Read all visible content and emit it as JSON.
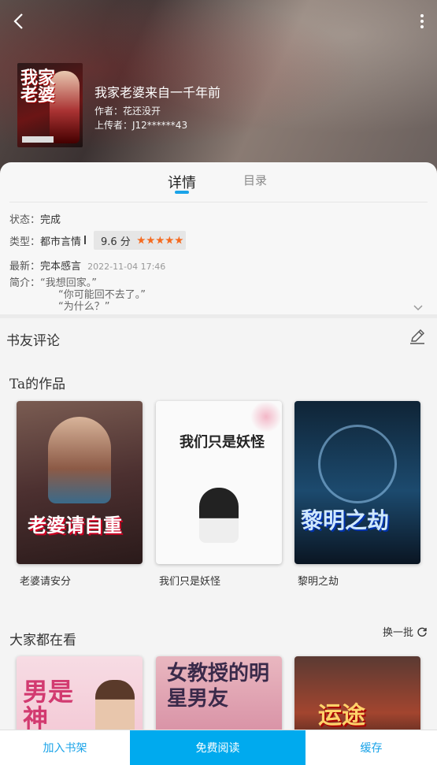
{
  "header": {
    "back_icon": "chevron-left-icon",
    "more_icon": "more-vertical-icon",
    "book_title": "我家老婆来自一千年前",
    "author": "作者：花还没开",
    "uploader": "上传者：J12******43",
    "cover_text": "我家老婆"
  },
  "tabs": [
    {
      "label": "详情"
    },
    {
      "label": "目录"
    }
  ],
  "details": {
    "status_label": "状态：",
    "status_value": "完成",
    "type_label": "类型：",
    "type_value": "都市言情",
    "score": "9.6 分",
    "rating_stars": 5,
    "latest_label": "最新：",
    "latest_value": "完本感言",
    "latest_time": "2022-11-04 17:46",
    "intro_label": "简介：",
    "intro_lines": [
      "“我想回家。”",
      "“你可能回不去了。”",
      "“为什么？”"
    ]
  },
  "comments": {
    "title": "书友评论"
  },
  "works": {
    "title": "Ta的作品",
    "books": [
      {
        "name": "老婆请安分",
        "cover_text": "老婆请自重"
      },
      {
        "name": "我们只是妖怪",
        "cover_text": "我们只是妖怪"
      },
      {
        "name": "黎明之劫",
        "cover_text": "黎明之劫"
      }
    ]
  },
  "popular": {
    "title": "大家都在看",
    "refresh_label": "换一批",
    "books": [
      {
        "cover_text": "男是神"
      },
      {
        "cover_text": "女教授的明星男友"
      },
      {
        "cover_text": "运途"
      }
    ]
  },
  "bottom_bar": {
    "add_shelf": "加入书架",
    "free_read": "免费阅读",
    "cache": "缓存"
  },
  "colors": {
    "accent": "#1aa3e8",
    "star": "#f56a1f",
    "read_button": "#00aaee"
  }
}
